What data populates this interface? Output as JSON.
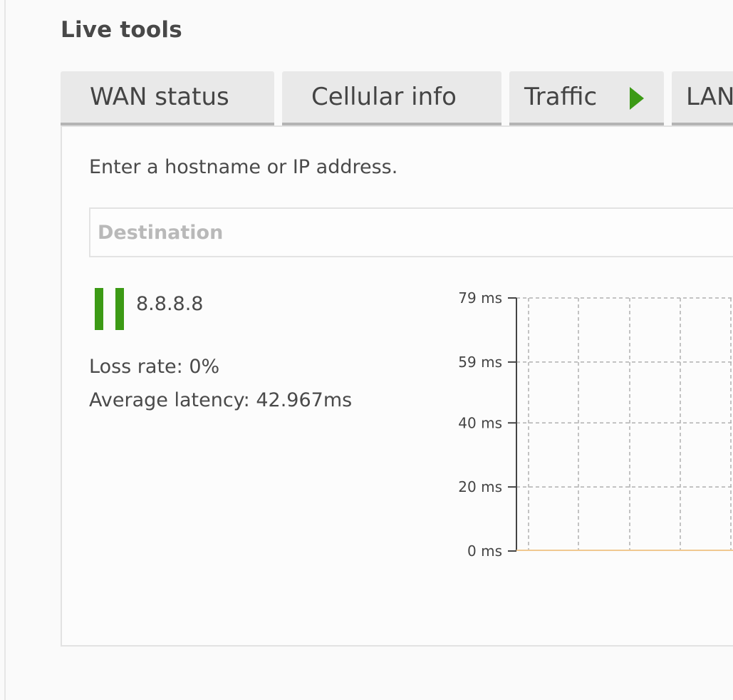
{
  "section": {
    "title": "Live tools"
  },
  "tabs": [
    {
      "label": "WAN status",
      "active": false
    },
    {
      "label": "Cellular info",
      "active": false
    },
    {
      "label": "Traffic",
      "active": false,
      "icon": "play-icon"
    },
    {
      "label": "LAN",
      "active": false
    }
  ],
  "ping": {
    "prompt": "Enter a hostname or IP address.",
    "destination_placeholder": "Destination",
    "destination_value": "",
    "host": "8.8.8.8",
    "control_icon": "pause-icon",
    "loss_rate": "Loss rate: 0%",
    "average_latency": "Average latency: 42.967ms"
  },
  "colors": {
    "accent_green": "#3c9a15",
    "grid": "#b0b0b0",
    "baseline": "#f0c890"
  },
  "chart_data": {
    "type": "line",
    "title": "",
    "xlabel": "",
    "ylabel": "",
    "ylim": [
      0,
      79
    ],
    "y_ticks": [
      "79 ms",
      "59 ms",
      "40 ms",
      "20 ms",
      "0 ms"
    ],
    "grid": true,
    "series": [
      {
        "values": [
          0,
          0,
          0,
          0,
          0
        ]
      }
    ]
  }
}
